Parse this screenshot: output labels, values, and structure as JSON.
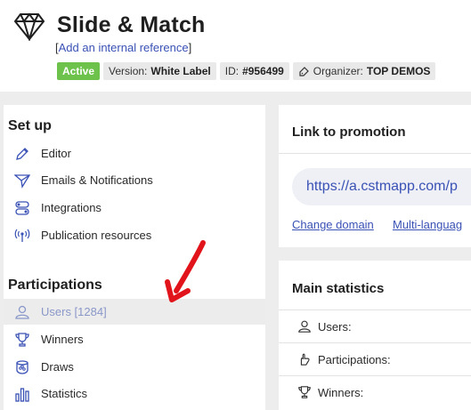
{
  "header": {
    "title": "Slide & Match",
    "ref_bracket_open": "[",
    "ref_link": "Add an internal reference",
    "ref_bracket_close": "]",
    "badges": {
      "status": "Active",
      "version_label": "Version:",
      "version_value": "White Label",
      "id_label": "ID:",
      "id_value": "#956499",
      "organizer_label": "Organizer:",
      "organizer_value": "TOP DEMOS"
    }
  },
  "setup": {
    "title": "Set up",
    "items": [
      {
        "label": "Editor",
        "icon": "pencil-icon"
      },
      {
        "label": "Emails & Notifications",
        "icon": "paper-plane-icon"
      },
      {
        "label": "Integrations",
        "icon": "toggles-icon"
      },
      {
        "label": "Publication resources",
        "icon": "broadcast-icon"
      }
    ]
  },
  "participations": {
    "title": "Participations",
    "items": [
      {
        "label": "Users [1284]",
        "icon": "user-icon",
        "selected": true
      },
      {
        "label": "Winners",
        "icon": "trophy-icon"
      },
      {
        "label": "Draws",
        "icon": "draw-bowl-icon"
      },
      {
        "label": "Statistics",
        "icon": "bar-chart-icon"
      }
    ]
  },
  "promotion": {
    "title": "Link to promotion",
    "url": "https://a.cstmapp.com/p",
    "change_domain": "Change domain",
    "multi_language": "Multi-languag"
  },
  "stats": {
    "title": "Main statistics",
    "rows": [
      {
        "label": "Users:",
        "icon": "user-icon"
      },
      {
        "label": "Participations:",
        "icon": "hand-icon"
      },
      {
        "label": "Winners:",
        "icon": "trophy-icon"
      }
    ]
  },
  "colors": {
    "accent": "#3a51b5",
    "active_badge": "#6cc24a",
    "arrow": "#e2141b"
  }
}
